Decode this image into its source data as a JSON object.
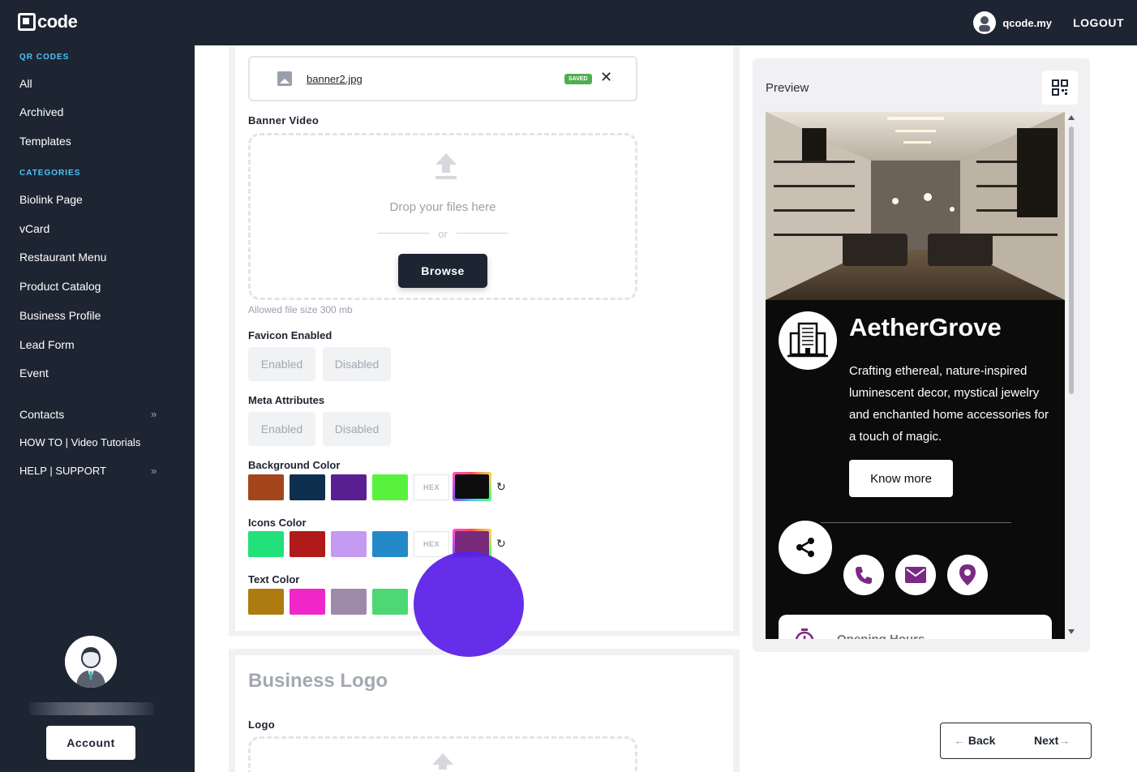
{
  "topbar": {
    "logo_text": "code",
    "username": "qcode.my",
    "logout_label": "LOGOUT"
  },
  "sidebar": {
    "section_qr": "QR CODES",
    "qr_items": [
      "All",
      "Archived",
      "Templates"
    ],
    "section_categories": "CATEGORIES",
    "category_items": [
      "Biolink Page",
      "vCard",
      "Restaurant Menu",
      "Product Catalog",
      "Business Profile",
      "Lead Form",
      "Event"
    ],
    "extra_items": [
      "Contacts",
      "HOW TO | Video Tutorials",
      "HELP | SUPPORT"
    ],
    "account_label": "Account"
  },
  "form": {
    "banner_file": {
      "name": "banner2.jpg",
      "badge": "SAVED"
    },
    "banner_video": {
      "label": "Banner Video",
      "drop_text": "Drop your files here",
      "or_text": "or",
      "browse_label": "Browse",
      "allowed_text": "Allowed file size  300 mb"
    },
    "favicon": {
      "label": "Favicon Enabled",
      "enabled": "Enabled",
      "disabled": "Disabled"
    },
    "meta": {
      "label": "Meta Attributes",
      "enabled": "Enabled",
      "disabled": "Disabled"
    },
    "background_color": {
      "label": "Background Color",
      "swatches": [
        "#a4461c",
        "#0f2f4f",
        "#5b1f94",
        "#58f23e"
      ],
      "hex_label": "HEX",
      "current": "#0d0d0d"
    },
    "icons_color": {
      "label": "Icons Color",
      "swatches": [
        "#22e07a",
        "#b01a1a",
        "#c59af2",
        "#2489c9"
      ],
      "hex_label": "HEX",
      "current": "#7a2a7a"
    },
    "text_color": {
      "label": "Text Color",
      "swatches": [
        "#ae7b10",
        "#ef27cb",
        "#9d8aa8",
        "#4dd873"
      ]
    },
    "business_logo": {
      "title": "Business Logo",
      "logo_label": "Logo"
    }
  },
  "preview": {
    "label": "Preview",
    "business_name": "AetherGrove",
    "description": "Crafting ethereal, nature-inspired luminescent decor, mystical jewelry and enchanted home accessories for a touch of magic.",
    "button_label": "Know more",
    "hours_label": "Opening Hours"
  },
  "nav": {
    "back_label": "Back",
    "next_label": "Next"
  },
  "colors": {
    "dark": "#1e2532",
    "accent": "#4fc3f7",
    "fab": "#5a1ee6",
    "icon_purple": "#7b2a83"
  }
}
